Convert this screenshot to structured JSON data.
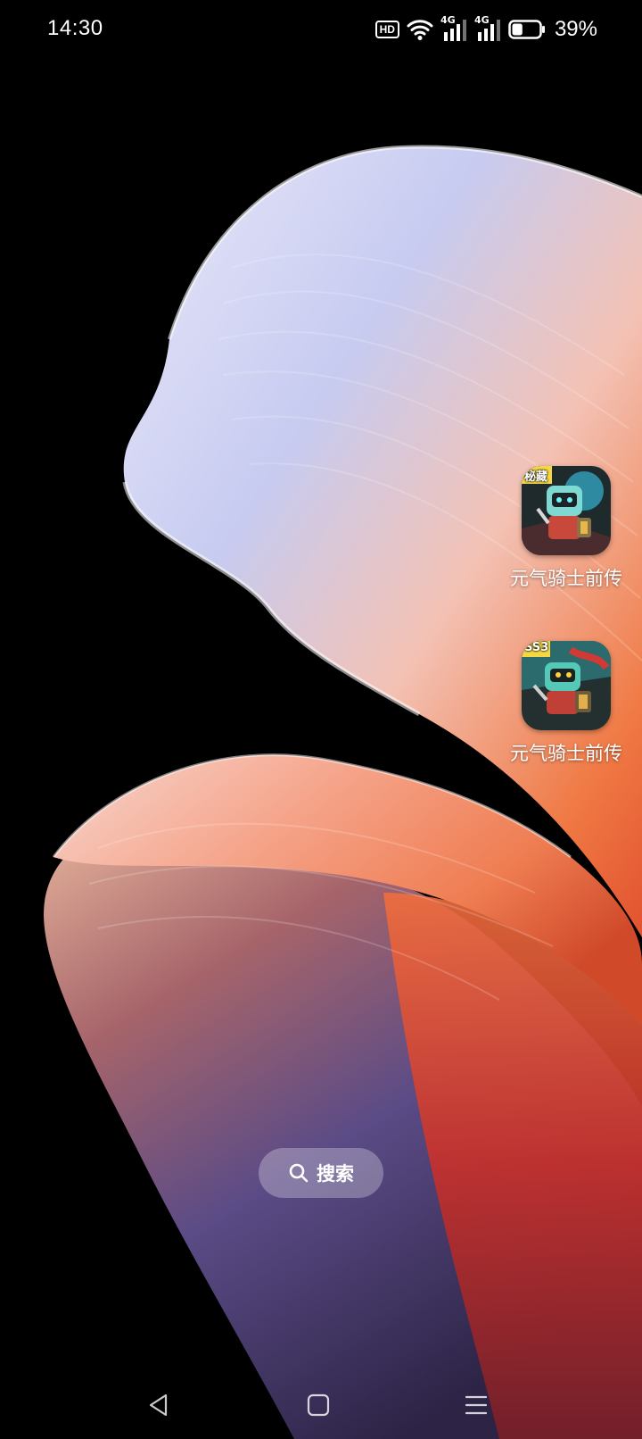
{
  "status_bar": {
    "time": "14:30",
    "hd_badge": "HD",
    "network_1": "4G",
    "network_2": "4G",
    "battery_percent": "39%",
    "battery_level": 0.39
  },
  "apps": [
    {
      "label": "元气骑士前传",
      "badge": "秘藏",
      "icon": "soul-knight-prequel-icon"
    },
    {
      "label": "元气骑士前传",
      "badge": "SS3",
      "icon": "soul-knight-prequel-icon"
    }
  ],
  "search": {
    "label": "搜索"
  },
  "nav": {
    "back": "back-icon",
    "home": "home-icon",
    "recents": "recents-icon"
  },
  "colors": {
    "background": "#000000",
    "wallpaper_lavender": "#c9cdf2",
    "wallpaper_orange": "#f07a45",
    "wallpaper_red": "#c9302a",
    "wallpaper_purple": "#5b4b86"
  }
}
